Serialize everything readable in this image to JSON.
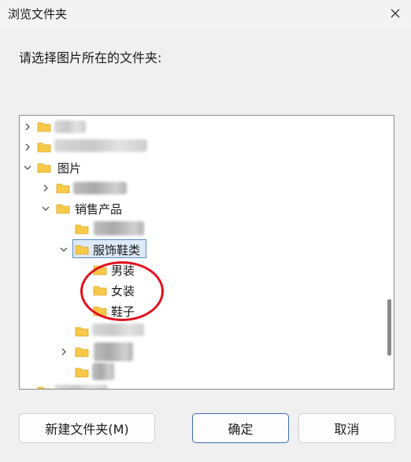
{
  "window": {
    "title": "浏览文件夹",
    "close_icon": "close-icon"
  },
  "prompt": "请选择图片所在的文件夹:",
  "tree": {
    "pictures_label": "图片",
    "sales_label": "销售产品",
    "clothing_label": "服饰鞋类",
    "men_label": "男装",
    "women_label": "女装",
    "shoes_label": "鞋子"
  },
  "buttons": {
    "new_folder": "新建文件夹(M)",
    "ok": "确定",
    "cancel": "取消"
  },
  "colors": {
    "folder_yellow": "#f7c948",
    "selection_bg": "#dde9f7",
    "annotation_red": "#e0101c",
    "primary_border": "#3f6fb3"
  }
}
